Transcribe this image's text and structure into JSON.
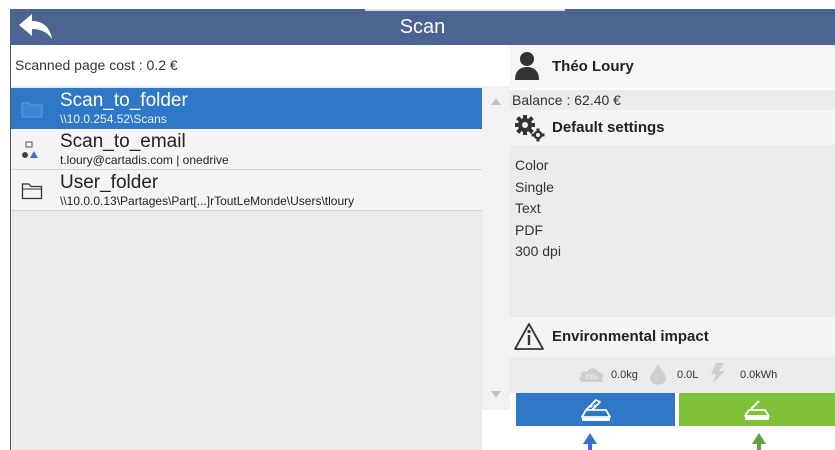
{
  "header": {
    "title": "Scan",
    "back_icon": "back-arrow-icon",
    "color": "#4b6491"
  },
  "left": {
    "cost_label": "Scanned page cost : 0.2 €",
    "destinations": [
      {
        "name": "Scan_to_folder",
        "path": "\\\\10.0.254.52\\Scans",
        "icon": "folder-icon",
        "selected": true
      },
      {
        "name": "Scan_to_email",
        "path": "t.loury@cartadis.com | onedrive",
        "icon": "email-share-icon",
        "selected": false
      },
      {
        "name": "User_folder",
        "path": "\\\\10.0.0.13\\Partages\\Part[...]rToutLeMonde\\Users\\tloury",
        "icon": "folder-icon",
        "selected": false
      }
    ],
    "selected_color": "#2e78c7"
  },
  "right": {
    "user_name": "Théo Loury",
    "balance": "Balance : 62.40 €",
    "default_settings_label": "Default settings",
    "settings": [
      "Color",
      "Single",
      "Text",
      "PDF",
      "300 dpi"
    ],
    "env_label": "Environmental impact",
    "env": {
      "co2_value": "0.0kg",
      "water_value": "0.0L",
      "energy_value": "0.0kWh"
    }
  },
  "actions": {
    "scan_glass_color": "#2e78c7",
    "scan_feeder_color": "#7fc23a"
  }
}
